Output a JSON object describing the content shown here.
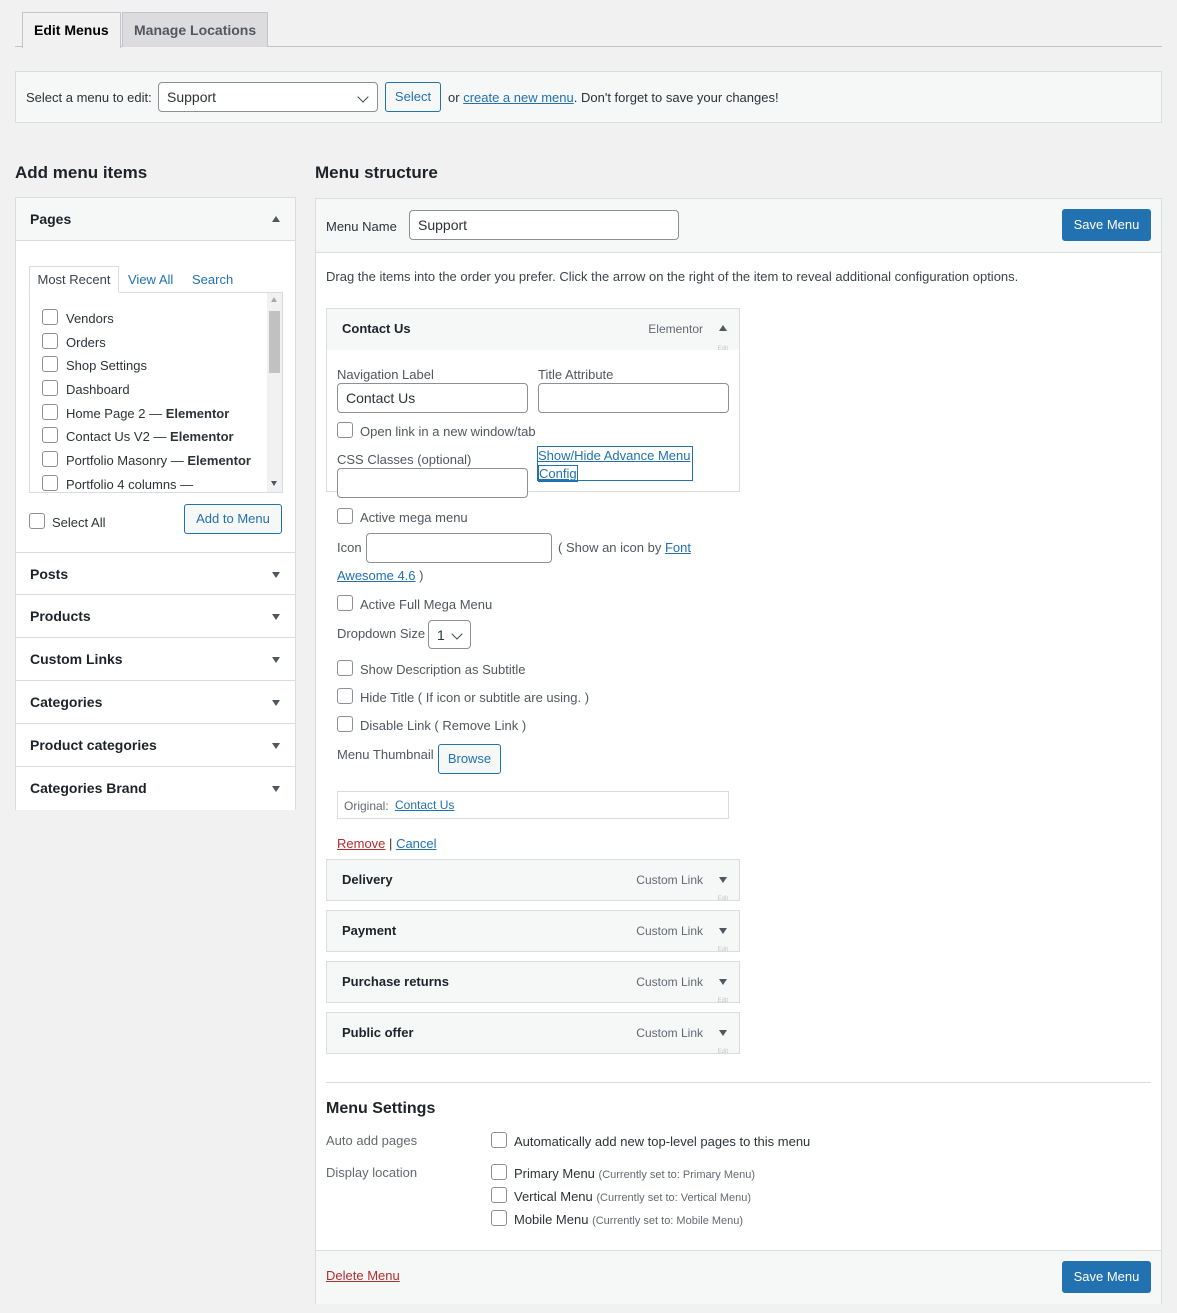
{
  "tabs": {
    "edit_menus": "Edit Menus",
    "manage_locations": "Manage Locations"
  },
  "manage": {
    "label": "Select a menu to edit:",
    "selected_menu": "Support",
    "select_button": "Select",
    "or_text": "or",
    "create_link": "create a new menu",
    "reminder": ". Don't forget to save your changes!"
  },
  "left": {
    "title": "Add menu items",
    "pages": {
      "title": "Pages",
      "tabs": [
        "Most Recent",
        "View All",
        "Search"
      ],
      "items": [
        {
          "label": "Vendors",
          "suffix": ""
        },
        {
          "label": "Orders",
          "suffix": ""
        },
        {
          "label": "Shop Settings",
          "suffix": ""
        },
        {
          "label": "Dashboard",
          "suffix": ""
        },
        {
          "label": "Home Page 2 — ",
          "suffix": "Elementor"
        },
        {
          "label": "Contact Us V2 — ",
          "suffix": "Elementor"
        },
        {
          "label": "Portfolio Masonry — ",
          "suffix": "Elementor"
        },
        {
          "label": "Portfolio 4 columns —",
          "suffix": ""
        }
      ],
      "select_all": "Select All",
      "add_button": "Add to Menu"
    },
    "sections": [
      "Posts",
      "Products",
      "Custom Links",
      "Categories",
      "Product categories",
      "Categories Brand"
    ]
  },
  "right": {
    "title": "Menu structure",
    "menu_name_label": "Menu Name",
    "menu_name_value": "Support",
    "save_button": "Save Menu",
    "instructions": "Drag the items into the order you prefer. Click the arrow on the right of the item to reveal additional configuration options.",
    "edit_tiny": "Edit",
    "open_item": {
      "title": "Contact Us",
      "type": "Elementor",
      "nav_label_title": "Navigation Label",
      "nav_label_value": "Contact Us",
      "title_attr_title": "Title Attribute",
      "title_attr_value": "",
      "open_new_window": "Open link in a new window/tab",
      "css_classes": "CSS Classes (optional)",
      "advance_link_line1": "Show/Hide Advance Menu",
      "advance_link_line2": "Config",
      "active_mega": "Active mega menu",
      "icon_label": "Icon",
      "icon_hint_pre": "( Show an icon by ",
      "icon_hint_link1": "Font",
      "icon_hint_link2": "Awesome 4.6",
      "icon_hint_post": " )",
      "active_full_mega": "Active Full Mega Menu",
      "dropdown_size_label": "Dropdown Size",
      "dropdown_size_value": "1",
      "show_description": "Show Description as Subtitle",
      "hide_title": "Hide Title ( If icon or subtitle are using. )",
      "disable_link": "Disable Link ( Remove Link )",
      "thumbnail_label": "Menu Thumbnail",
      "browse_button": "Browse",
      "original_label": "Original:",
      "original_link": "Contact Us",
      "remove": "Remove",
      "separator": "|",
      "cancel": "Cancel"
    },
    "items": [
      {
        "title": "Delivery",
        "type": "Custom Link"
      },
      {
        "title": "Payment",
        "type": "Custom Link"
      },
      {
        "title": "Purchase returns",
        "type": "Custom Link"
      },
      {
        "title": "Public offer",
        "type": "Custom Link"
      }
    ],
    "settings": {
      "title": "Menu Settings",
      "auto_add_label": "Auto add pages",
      "auto_add_option": "Automatically add new top-level pages to this menu",
      "display_location_label": "Display location",
      "locations": [
        {
          "name": "Primary Menu",
          "note": "(Currently set to: Primary Menu)"
        },
        {
          "name": "Vertical Menu",
          "note": "(Currently set to: Vertical Menu)"
        },
        {
          "name": "Mobile Menu",
          "note": "(Currently set to: Mobile Menu)"
        }
      ]
    },
    "delete_menu": "Delete Menu"
  },
  "colors": {
    "primary": "#2271b1",
    "danger": "#b32d2e",
    "background": "#f1f1f1"
  }
}
